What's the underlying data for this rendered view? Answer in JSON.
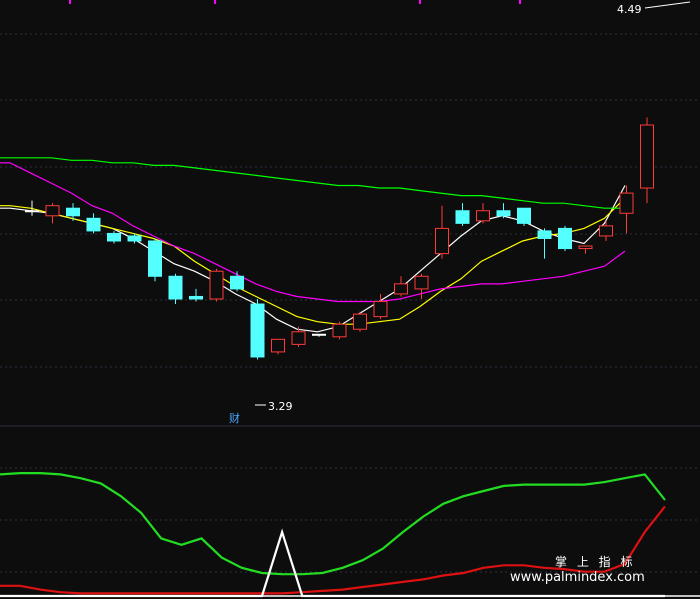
{
  "chart_data": {
    "type": "candlestick",
    "main_panel": {
      "ylim": [
        2.9,
        4.55
      ],
      "grid": true,
      "candles": [
        {
          "o": 3.73,
          "h": 3.77,
          "l": 3.71,
          "c": 3.73
        },
        {
          "o": 3.71,
          "h": 3.76,
          "l": 3.68,
          "c": 3.75
        },
        {
          "o": 3.74,
          "h": 3.76,
          "l": 3.69,
          "c": 3.71
        },
        {
          "o": 3.7,
          "h": 3.72,
          "l": 3.64,
          "c": 3.65
        },
        {
          "o": 3.64,
          "h": 3.65,
          "l": 3.6,
          "c": 3.61
        },
        {
          "o": 3.63,
          "h": 3.64,
          "l": 3.6,
          "c": 3.61
        },
        {
          "o": 3.61,
          "h": 3.62,
          "l": 3.45,
          "c": 3.47
        },
        {
          "o": 3.47,
          "h": 3.48,
          "l": 3.36,
          "c": 3.38
        },
        {
          "o": 3.39,
          "h": 3.42,
          "l": 3.37,
          "c": 3.38
        },
        {
          "o": 3.38,
          "h": 3.5,
          "l": 3.37,
          "c": 3.49
        },
        {
          "o": 3.47,
          "h": 3.49,
          "l": 3.41,
          "c": 3.42
        },
        {
          "o": 3.36,
          "h": 3.38,
          "l": 3.14,
          "c": 3.15
        },
        {
          "o": 3.17,
          "h": 3.22,
          "l": 3.16,
          "c": 3.22
        },
        {
          "o": 3.2,
          "h": 3.27,
          "l": 3.19,
          "c": 3.25
        },
        {
          "o": 3.24,
          "h": 3.24,
          "l": 3.23,
          "c": 3.24
        },
        {
          "o": 3.23,
          "h": 3.29,
          "l": 3.22,
          "c": 3.28
        },
        {
          "o": 3.26,
          "h": 3.33,
          "l": 3.25,
          "c": 3.32
        },
        {
          "o": 3.31,
          "h": 3.4,
          "l": 3.3,
          "c": 3.37
        },
        {
          "o": 3.4,
          "h": 3.47,
          "l": 3.39,
          "c": 3.44
        },
        {
          "o": 3.42,
          "h": 3.48,
          "l": 3.38,
          "c": 3.47
        },
        {
          "o": 3.56,
          "h": 3.75,
          "l": 3.54,
          "c": 3.66
        },
        {
          "o": 3.73,
          "h": 3.76,
          "l": 3.67,
          "c": 3.68
        },
        {
          "o": 3.69,
          "h": 3.76,
          "l": 3.68,
          "c": 3.73
        },
        {
          "o": 3.73,
          "h": 3.76,
          "l": 3.7,
          "c": 3.71
        },
        {
          "o": 3.74,
          "h": 3.74,
          "l": 3.67,
          "c": 3.68
        },
        {
          "o": 3.65,
          "h": 3.66,
          "l": 3.54,
          "c": 3.62
        },
        {
          "o": 3.66,
          "h": 3.67,
          "l": 3.57,
          "c": 3.58
        },
        {
          "o": 3.58,
          "h": 3.59,
          "l": 3.56,
          "c": 3.59
        },
        {
          "o": 3.63,
          "h": 3.69,
          "l": 3.61,
          "c": 3.67
        },
        {
          "o": 3.72,
          "h": 3.83,
          "l": 3.64,
          "c": 3.8
        },
        {
          "o": 3.82,
          "h": 4.1,
          "l": 3.76,
          "c": 4.07
        }
      ],
      "moving_averages": [
        {
          "color": "#ffffff",
          "values": [
            3.74,
            3.73,
            3.72,
            3.7,
            3.68,
            3.66,
            3.62,
            3.57,
            3.52,
            3.49,
            3.45,
            3.4,
            3.36,
            3.3,
            3.26,
            3.25,
            3.27,
            3.32,
            3.37,
            3.42,
            3.49,
            3.56,
            3.63,
            3.69,
            3.71,
            3.69,
            3.65,
            3.62,
            3.6,
            3.68,
            3.83
          ]
        },
        {
          "color": "#ffff00",
          "values": [
            3.75,
            3.74,
            3.72,
            3.7,
            3.68,
            3.66,
            3.64,
            3.62,
            3.59,
            3.53,
            3.48,
            3.43,
            3.39,
            3.35,
            3.31,
            3.29,
            3.28,
            3.28,
            3.29,
            3.3,
            3.35,
            3.41,
            3.46,
            3.53,
            3.57,
            3.61,
            3.63,
            3.64,
            3.66,
            3.7,
            3.78
          ]
        },
        {
          "color": "#ff00ff",
          "values": [
            3.92,
            3.88,
            3.84,
            3.8,
            3.75,
            3.72,
            3.67,
            3.63,
            3.59,
            3.56,
            3.52,
            3.48,
            3.44,
            3.41,
            3.39,
            3.38,
            3.37,
            3.37,
            3.37,
            3.38,
            3.4,
            3.42,
            3.43,
            3.44,
            3.44,
            3.45,
            3.46,
            3.47,
            3.49,
            3.51,
            3.57
          ]
        },
        {
          "color": "#00ff00",
          "values": [
            3.94,
            3.94,
            3.94,
            3.93,
            3.93,
            3.92,
            3.92,
            3.91,
            3.91,
            3.9,
            3.89,
            3.88,
            3.87,
            3.86,
            3.85,
            3.84,
            3.83,
            3.83,
            3.82,
            3.82,
            3.81,
            3.8,
            3.79,
            3.79,
            3.78,
            3.77,
            3.76,
            3.76,
            3.75,
            3.74,
            3.74
          ]
        }
      ],
      "annotations": {
        "high": {
          "label": "4.49"
        },
        "low": {
          "label": "3.29"
        },
        "marker": {
          "label": "财"
        }
      }
    },
    "indicator_panel": {
      "ylim": [
        0,
        100
      ],
      "series": [
        {
          "color": "#22dd22",
          "values": [
            95,
            96,
            96,
            95,
            92,
            88,
            78,
            65,
            45,
            40,
            45,
            30,
            22,
            18,
            17,
            17,
            18,
            22,
            28,
            37,
            50,
            62,
            72,
            78,
            82,
            86,
            87,
            87,
            87,
            87,
            89,
            92,
            95,
            75
          ]
        },
        {
          "color": "#dd1111",
          "values": [
            8,
            8,
            5,
            3,
            2,
            2,
            2,
            2,
            2,
            2,
            2,
            2,
            2,
            2,
            2,
            3,
            4,
            5,
            7,
            9,
            11,
            13,
            16,
            18,
            22,
            24,
            24,
            22,
            21,
            19,
            19,
            25,
            50,
            70
          ]
        },
        {
          "color": "#ffffff",
          "values": [
            0,
            0,
            0,
            0,
            0,
            0,
            0,
            0,
            0,
            0,
            0,
            0,
            0,
            0,
            50,
            0,
            0,
            0,
            0,
            0,
            0,
            0,
            0,
            0,
            0,
            0,
            0,
            0,
            0,
            0,
            0,
            0,
            0,
            0
          ]
        }
      ]
    }
  },
  "watermark": {
    "line1": "掌 上 指 标",
    "line2": "www.palmindex.com"
  }
}
